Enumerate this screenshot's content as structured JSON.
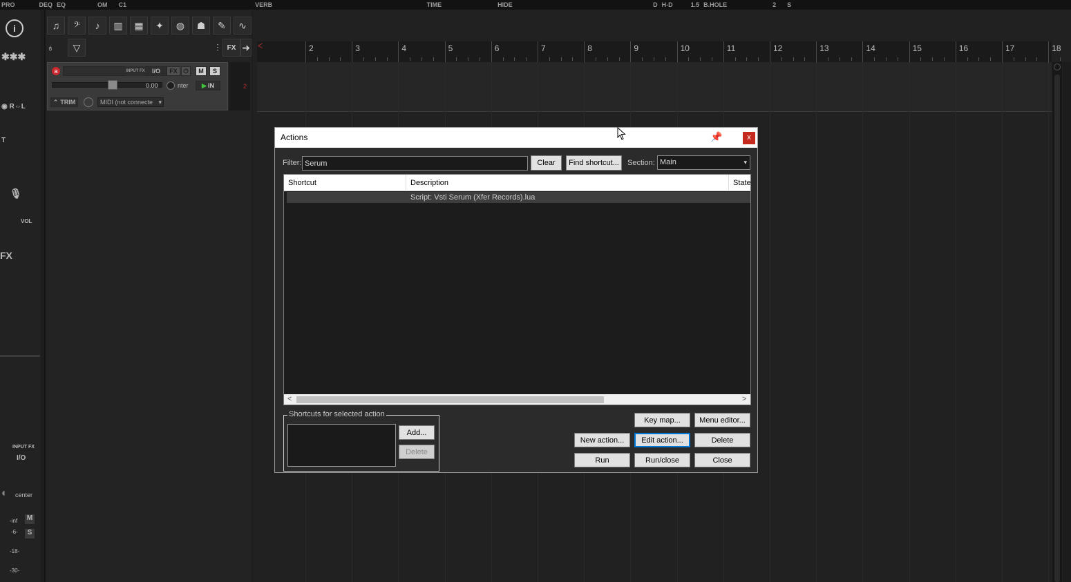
{
  "toolbar": {
    "items": [
      "PRO",
      "DEQ",
      "EQ",
      "OM",
      "C1",
      "VERB",
      "HIDE",
      "TIME",
      "D",
      "H-D",
      "1.5",
      "B.HOLE",
      "2",
      "S"
    ]
  },
  "track": {
    "input_fx_label": "INPUT FX",
    "io_label": "I/O",
    "fx_label": "FX",
    "mute_label": "M",
    "solo_label": "S",
    "volume_value": "0.00",
    "pan_label": "nter",
    "trim_label": "TRIM",
    "midi_input": "MIDI (not connecte",
    "input_badge": "IN",
    "record_icon": "a",
    "meter_number": "2"
  },
  "ruler": {
    "marks": [
      "2",
      "3",
      "4",
      "5",
      "6",
      "7",
      "8",
      "9",
      "10",
      "11",
      "12",
      "13",
      "14",
      "15",
      "16",
      "17",
      "18"
    ]
  },
  "left_strip": {
    "io_label": "I/O",
    "input_fx_label": "INPUT FX",
    "pan_label": "center",
    "mute_label": "M",
    "solo_label": "S",
    "db_labels": [
      "-inf",
      "-6-",
      "-18-",
      "-30-"
    ],
    "fx_label": "FX",
    "vol_label": "VOL"
  },
  "dialog": {
    "title": "Actions",
    "close_glyph": "x",
    "filter_label": "Filter:",
    "filter_value": "Serum",
    "clear_button": "Clear",
    "find_shortcut_button": "Find shortcut...",
    "section_label": "Section:",
    "section_value": "Main",
    "columns": [
      "Shortcut",
      "Description",
      "State"
    ],
    "rows": [
      {
        "shortcut": "",
        "description": "Script: Vsti Serum (Xfer Records).lua",
        "state": ""
      }
    ],
    "shortcuts_group_label": "Shortcuts for selected action",
    "add_button": "Add...",
    "delete_shortcut_button": "Delete",
    "key_map_button": "Key map...",
    "menu_editor_button": "Menu editor...",
    "new_action_button": "New action...",
    "edit_action_button": "Edit action...",
    "delete_button": "Delete",
    "run_button": "Run",
    "run_close_button": "Run/close",
    "close_button": "Close"
  }
}
